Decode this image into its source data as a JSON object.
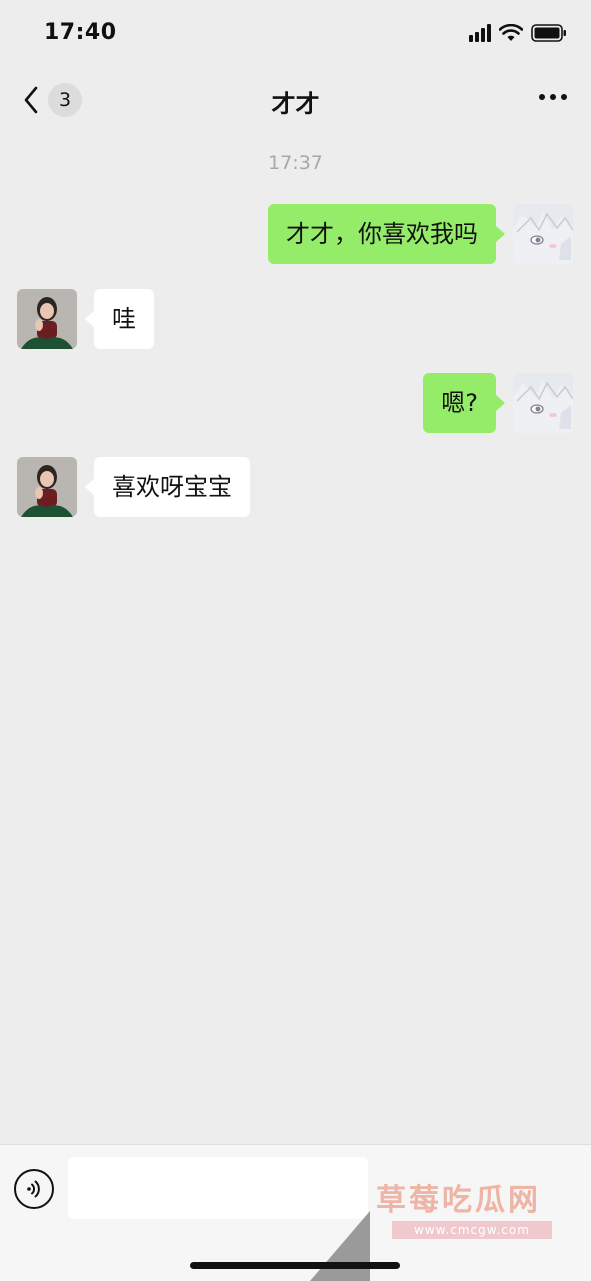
{
  "status_bar": {
    "time": "17:40"
  },
  "nav": {
    "unread_count": "3",
    "title": "才才"
  },
  "chat": {
    "timestamp": "17:37",
    "messages": [
      {
        "direction": "out",
        "text": "才才，你喜欢我吗"
      },
      {
        "direction": "in",
        "text": "哇"
      },
      {
        "direction": "out",
        "text": "嗯?"
      },
      {
        "direction": "in",
        "text": "喜欢呀宝宝"
      }
    ]
  },
  "input_bar": {
    "value": "",
    "watermark": "草莓吃瓜网",
    "watermark_url": "www.cmcgw.com"
  },
  "colors": {
    "background": "#ededed",
    "outgoing_bubble": "#95ec69",
    "incoming_bubble": "#ffffff",
    "timestamp": "#a8a8a8",
    "watermark": "#eeb5a6"
  },
  "icons": {
    "back": "chevron-left-icon",
    "more": "more-dots-icon",
    "voice": "voice-icon",
    "signal": "signal-icon",
    "wifi": "wifi-icon",
    "battery": "battery-icon"
  }
}
